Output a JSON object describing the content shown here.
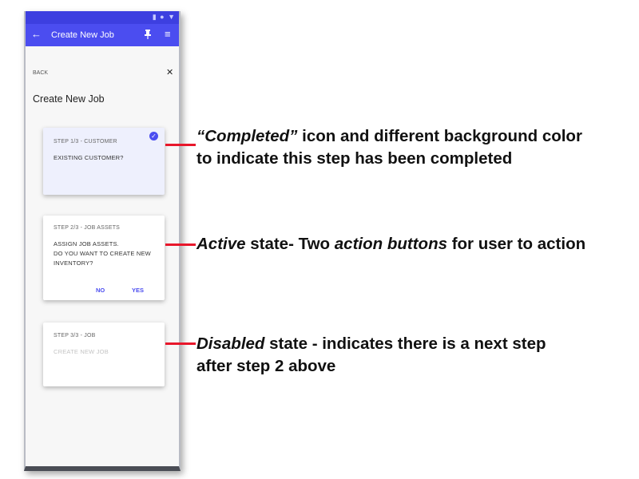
{
  "app": {
    "status_icons": "▮ ● ▼",
    "title": "Create New Job",
    "back_arrow": "←",
    "pin_icon": "pin-icon",
    "menu_icon": "≡"
  },
  "nav": {
    "back_label": "BACK",
    "close_label": "✕"
  },
  "page_title": "Create New Job",
  "steps": [
    {
      "step_label": "STEP 1/3 - CUSTOMER",
      "question": "EXISTING CUSTOMER?",
      "state": "completed",
      "check_icon": "✓"
    },
    {
      "step_label": "STEP 2/3 - JOB ASSETS",
      "question_lines": [
        "ASSIGN JOB ASSETS.",
        "DO YOU WANT TO CREATE NEW",
        "INVENTORY?"
      ],
      "state": "active",
      "no_label": "NO",
      "yes_label": "YES"
    },
    {
      "step_label": "STEP 3/3 - JOB",
      "question": "CREATE NEW JOB",
      "state": "disabled"
    }
  ],
  "annotations": {
    "completed": {
      "quote": "“Completed”",
      "line1_rest": " icon and different background color",
      "line2": "to indicate this step has been completed"
    },
    "active": {
      "em1": "Active",
      "text1": " state- Two ",
      "em2": "action buttons",
      "text2": " for user to action"
    },
    "disabled": {
      "em": "Disabled",
      "line1_rest": " state - indicates there is a next step",
      "line2": "after step 2 above"
    }
  },
  "colors": {
    "accent": "#4b4df0",
    "status_bar": "#3d3fe0",
    "completed_bg": "#eef0fd",
    "annotation_line": "#e8172b"
  }
}
